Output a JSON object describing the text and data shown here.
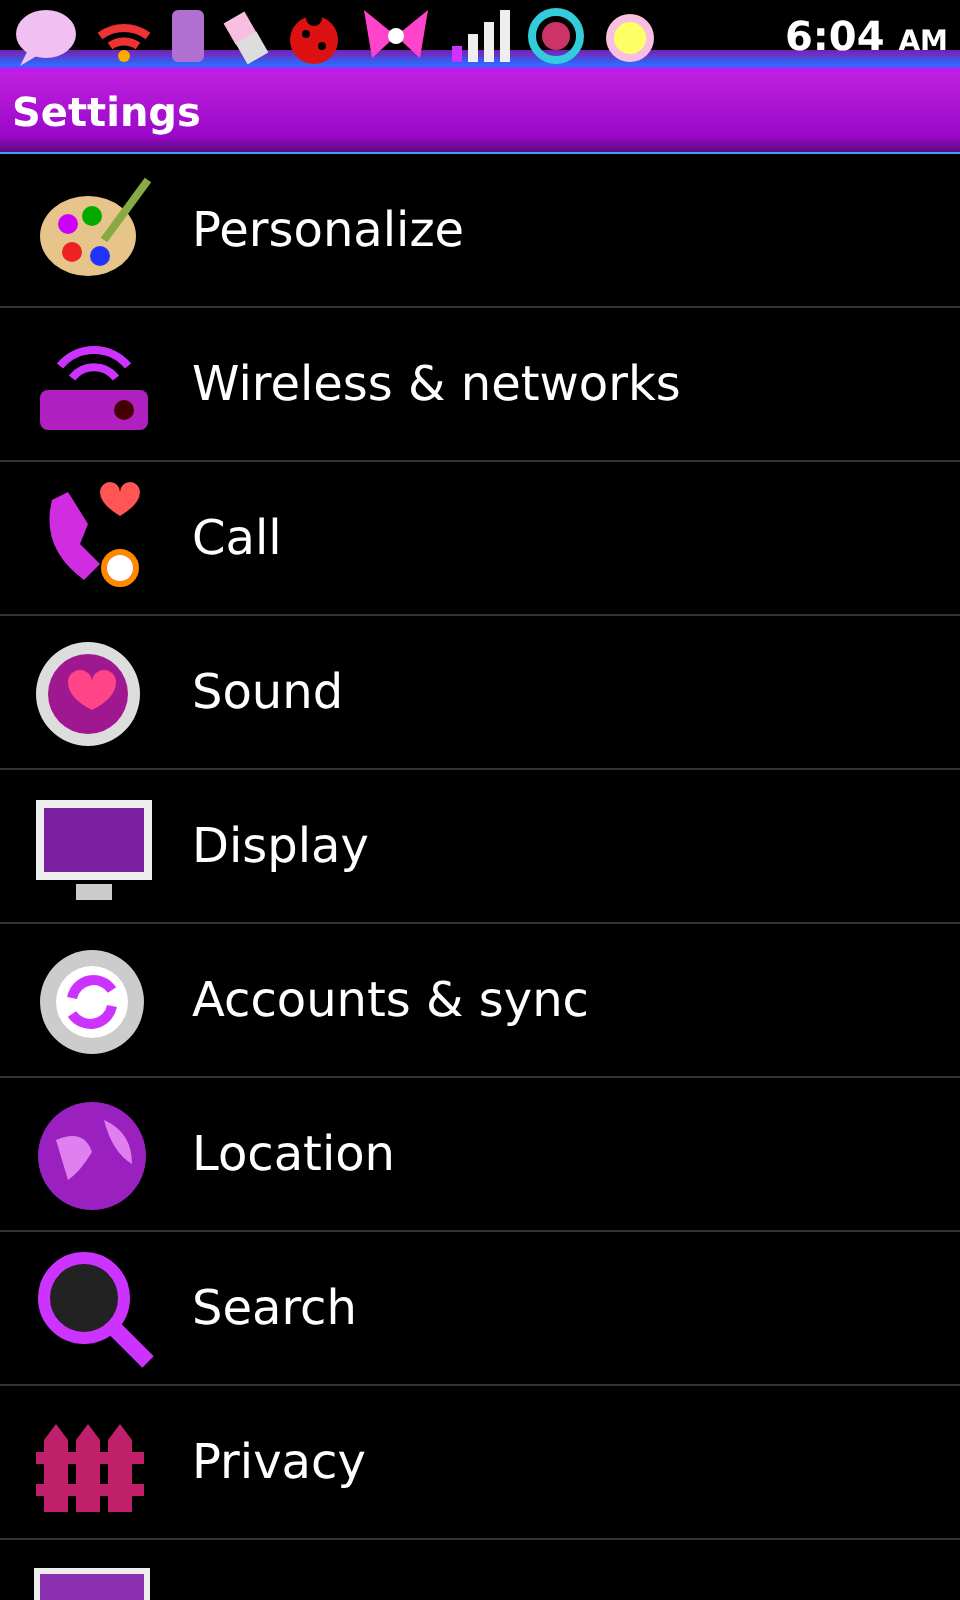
{
  "status_bar": {
    "time": "6:04",
    "period": "AM"
  },
  "title": "Settings",
  "items": [
    {
      "label": "Personalize"
    },
    {
      "label": "Wireless & networks"
    },
    {
      "label": "Call"
    },
    {
      "label": "Sound"
    },
    {
      "label": "Display"
    },
    {
      "label": "Accounts & sync"
    },
    {
      "label": "Location"
    },
    {
      "label": "Search"
    },
    {
      "label": "Privacy"
    }
  ]
}
